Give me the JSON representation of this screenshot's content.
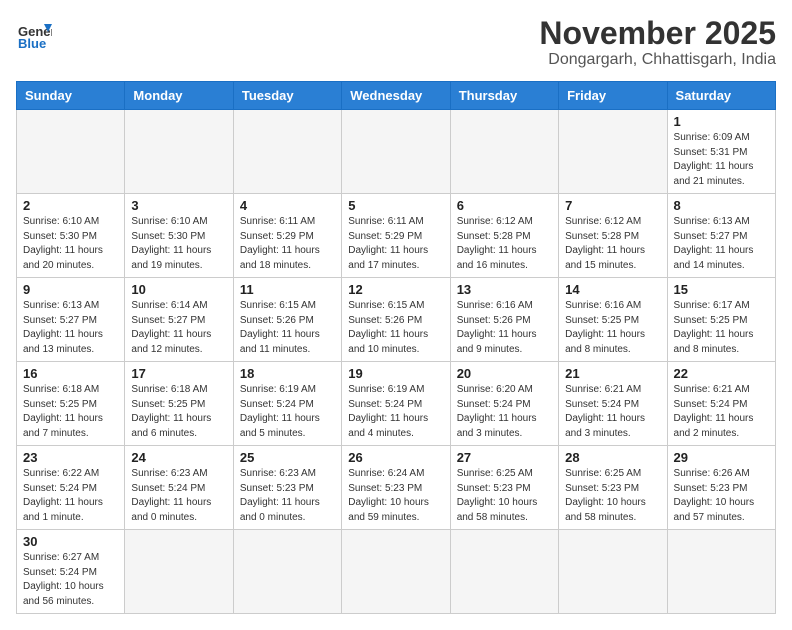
{
  "header": {
    "title": "November 2025",
    "location": "Dongargarh, Chhattisgarh, India",
    "logo_general": "General",
    "logo_blue": "Blue"
  },
  "weekdays": [
    "Sunday",
    "Monday",
    "Tuesday",
    "Wednesday",
    "Thursday",
    "Friday",
    "Saturday"
  ],
  "days": [
    {
      "date": "",
      "info": ""
    },
    {
      "date": "",
      "info": ""
    },
    {
      "date": "",
      "info": ""
    },
    {
      "date": "",
      "info": ""
    },
    {
      "date": "",
      "info": ""
    },
    {
      "date": "",
      "info": ""
    },
    {
      "date": "1",
      "info": "Sunrise: 6:09 AM\nSunset: 5:31 PM\nDaylight: 11 hours\nand 21 minutes."
    },
    {
      "date": "2",
      "info": "Sunrise: 6:10 AM\nSunset: 5:30 PM\nDaylight: 11 hours\nand 20 minutes."
    },
    {
      "date": "3",
      "info": "Sunrise: 6:10 AM\nSunset: 5:30 PM\nDaylight: 11 hours\nand 19 minutes."
    },
    {
      "date": "4",
      "info": "Sunrise: 6:11 AM\nSunset: 5:29 PM\nDaylight: 11 hours\nand 18 minutes."
    },
    {
      "date": "5",
      "info": "Sunrise: 6:11 AM\nSunset: 5:29 PM\nDaylight: 11 hours\nand 17 minutes."
    },
    {
      "date": "6",
      "info": "Sunrise: 6:12 AM\nSunset: 5:28 PM\nDaylight: 11 hours\nand 16 minutes."
    },
    {
      "date": "7",
      "info": "Sunrise: 6:12 AM\nSunset: 5:28 PM\nDaylight: 11 hours\nand 15 minutes."
    },
    {
      "date": "8",
      "info": "Sunrise: 6:13 AM\nSunset: 5:27 PM\nDaylight: 11 hours\nand 14 minutes."
    },
    {
      "date": "9",
      "info": "Sunrise: 6:13 AM\nSunset: 5:27 PM\nDaylight: 11 hours\nand 13 minutes."
    },
    {
      "date": "10",
      "info": "Sunrise: 6:14 AM\nSunset: 5:27 PM\nDaylight: 11 hours\nand 12 minutes."
    },
    {
      "date": "11",
      "info": "Sunrise: 6:15 AM\nSunset: 5:26 PM\nDaylight: 11 hours\nand 11 minutes."
    },
    {
      "date": "12",
      "info": "Sunrise: 6:15 AM\nSunset: 5:26 PM\nDaylight: 11 hours\nand 10 minutes."
    },
    {
      "date": "13",
      "info": "Sunrise: 6:16 AM\nSunset: 5:26 PM\nDaylight: 11 hours\nand 9 minutes."
    },
    {
      "date": "14",
      "info": "Sunrise: 6:16 AM\nSunset: 5:25 PM\nDaylight: 11 hours\nand 8 minutes."
    },
    {
      "date": "15",
      "info": "Sunrise: 6:17 AM\nSunset: 5:25 PM\nDaylight: 11 hours\nand 8 minutes."
    },
    {
      "date": "16",
      "info": "Sunrise: 6:18 AM\nSunset: 5:25 PM\nDaylight: 11 hours\nand 7 minutes."
    },
    {
      "date": "17",
      "info": "Sunrise: 6:18 AM\nSunset: 5:25 PM\nDaylight: 11 hours\nand 6 minutes."
    },
    {
      "date": "18",
      "info": "Sunrise: 6:19 AM\nSunset: 5:24 PM\nDaylight: 11 hours\nand 5 minutes."
    },
    {
      "date": "19",
      "info": "Sunrise: 6:19 AM\nSunset: 5:24 PM\nDaylight: 11 hours\nand 4 minutes."
    },
    {
      "date": "20",
      "info": "Sunrise: 6:20 AM\nSunset: 5:24 PM\nDaylight: 11 hours\nand 3 minutes."
    },
    {
      "date": "21",
      "info": "Sunrise: 6:21 AM\nSunset: 5:24 PM\nDaylight: 11 hours\nand 3 minutes."
    },
    {
      "date": "22",
      "info": "Sunrise: 6:21 AM\nSunset: 5:24 PM\nDaylight: 11 hours\nand 2 minutes."
    },
    {
      "date": "23",
      "info": "Sunrise: 6:22 AM\nSunset: 5:24 PM\nDaylight: 11 hours\nand 1 minute."
    },
    {
      "date": "24",
      "info": "Sunrise: 6:23 AM\nSunset: 5:24 PM\nDaylight: 11 hours\nand 0 minutes."
    },
    {
      "date": "25",
      "info": "Sunrise: 6:23 AM\nSunset: 5:23 PM\nDaylight: 11 hours\nand 0 minutes."
    },
    {
      "date": "26",
      "info": "Sunrise: 6:24 AM\nSunset: 5:23 PM\nDaylight: 10 hours\nand 59 minutes."
    },
    {
      "date": "27",
      "info": "Sunrise: 6:25 AM\nSunset: 5:23 PM\nDaylight: 10 hours\nand 58 minutes."
    },
    {
      "date": "28",
      "info": "Sunrise: 6:25 AM\nSunset: 5:23 PM\nDaylight: 10 hours\nand 58 minutes."
    },
    {
      "date": "29",
      "info": "Sunrise: 6:26 AM\nSunset: 5:23 PM\nDaylight: 10 hours\nand 57 minutes."
    },
    {
      "date": "30",
      "info": "Sunrise: 6:27 AM\nSunset: 5:24 PM\nDaylight: 10 hours\nand 56 minutes."
    },
    {
      "date": "",
      "info": ""
    },
    {
      "date": "",
      "info": ""
    },
    {
      "date": "",
      "info": ""
    },
    {
      "date": "",
      "info": ""
    },
    {
      "date": "",
      "info": ""
    },
    {
      "date": "",
      "info": ""
    }
  ]
}
